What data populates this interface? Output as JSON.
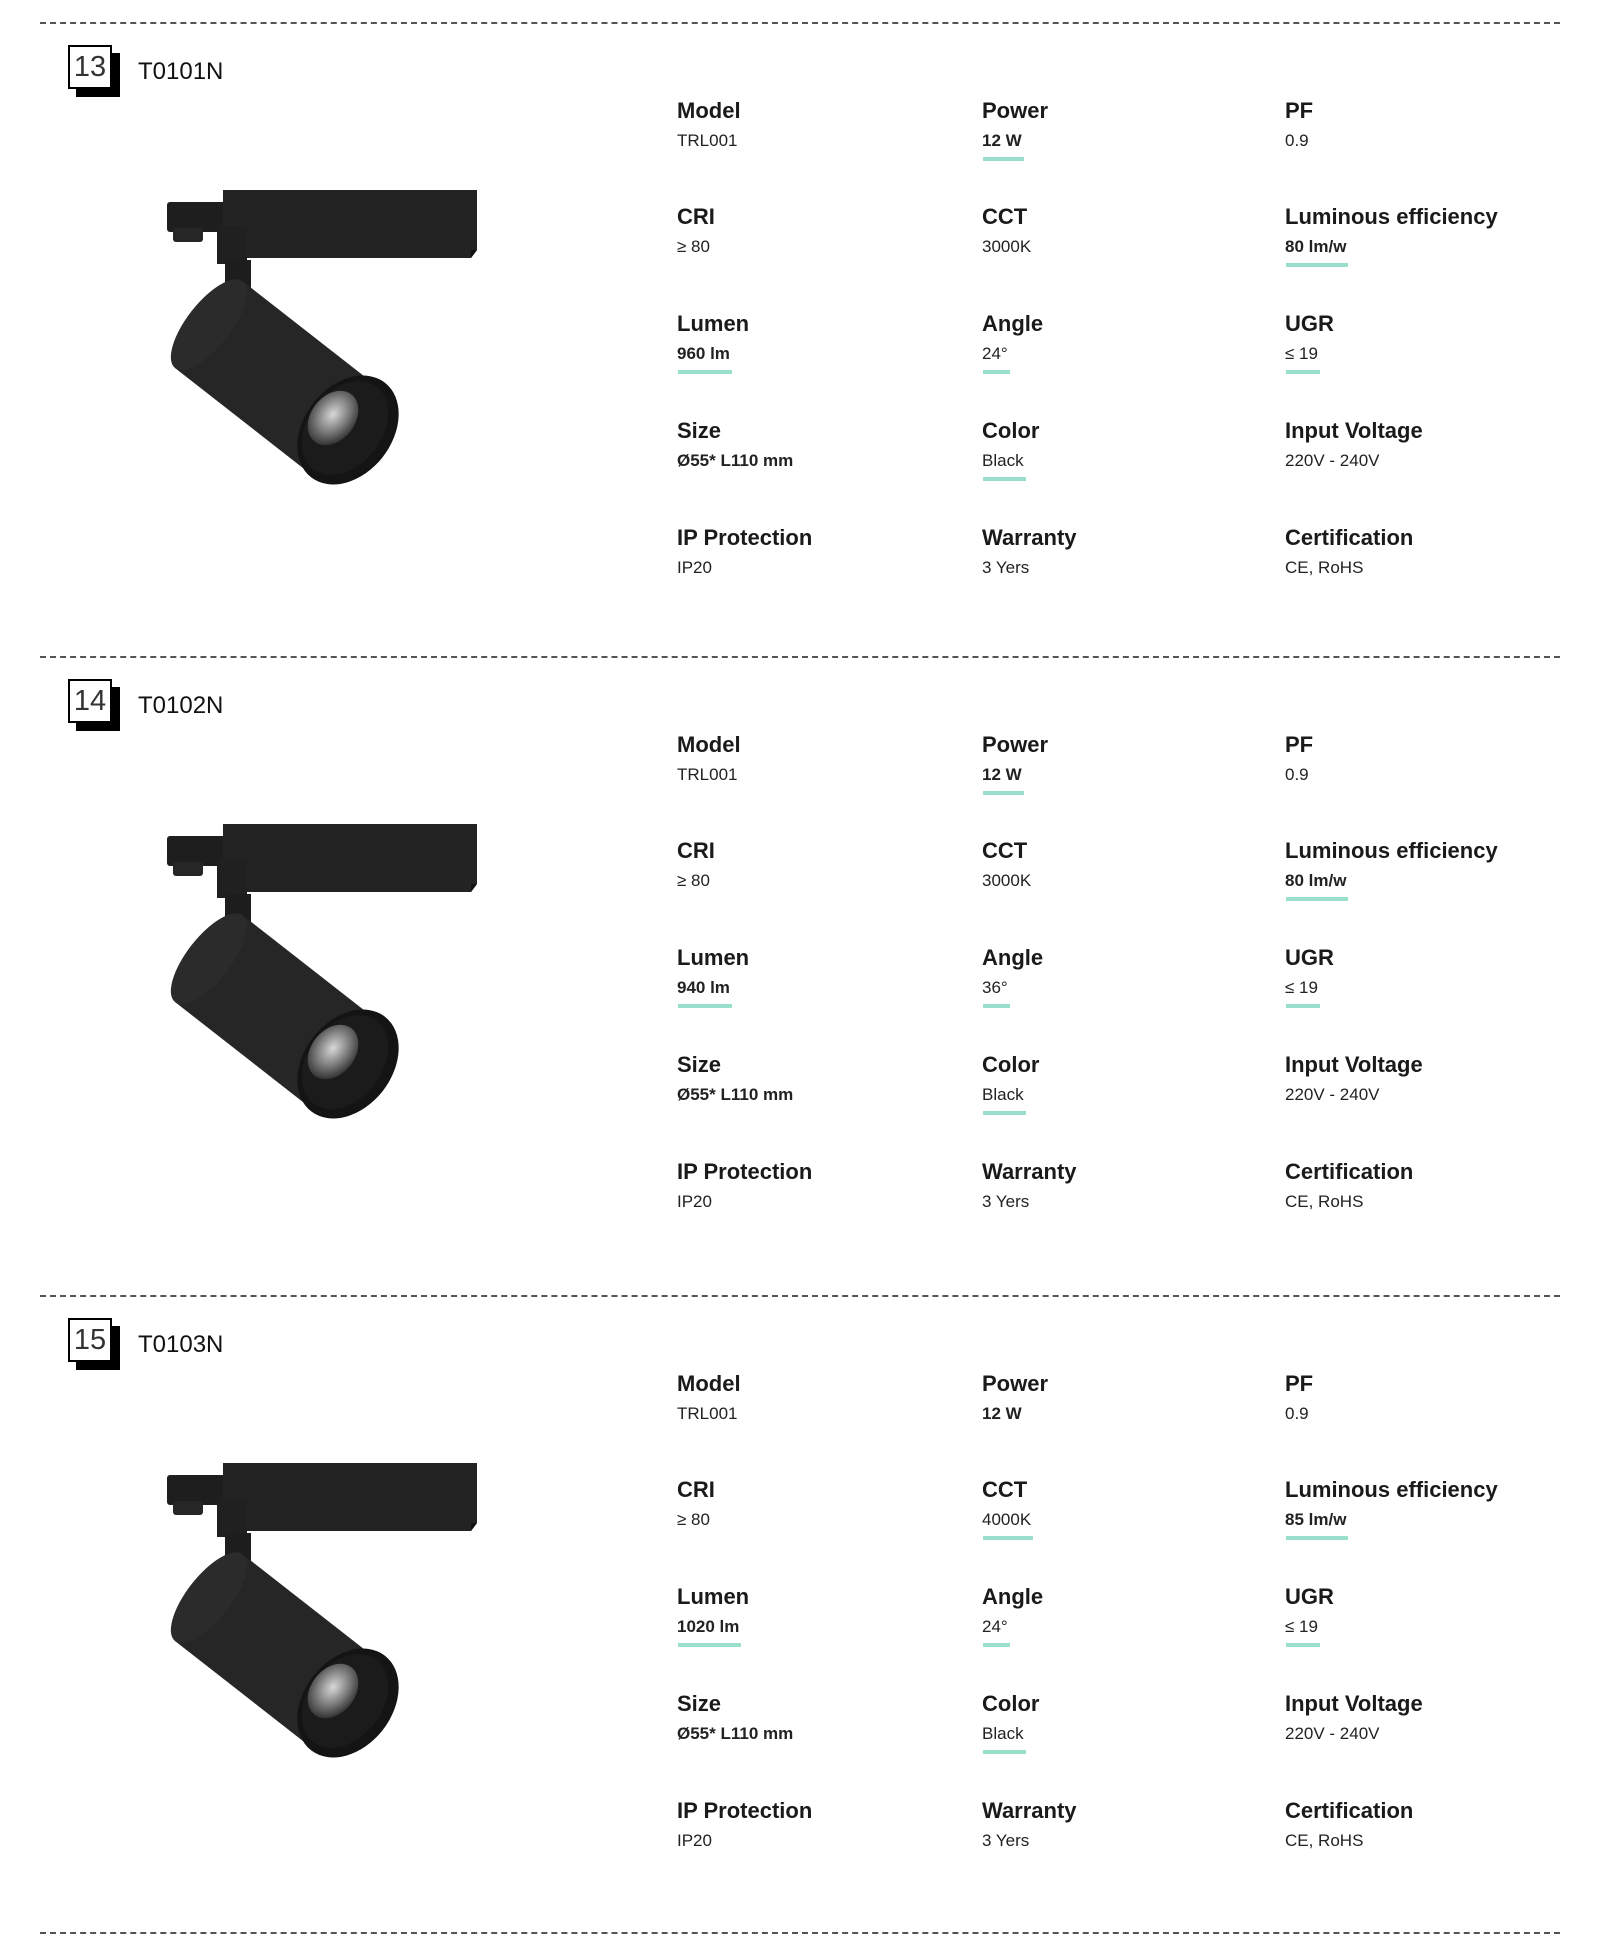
{
  "accent_color": "#9ADFCB",
  "products": [
    {
      "number": "13",
      "code": "T0101N",
      "image": "black-track-spotlight",
      "specs": [
        {
          "label": "Model",
          "value": "TRL001",
          "bold": false,
          "underline": false
        },
        {
          "label": "Power",
          "value": "12 W",
          "bold": true,
          "underline": true
        },
        {
          "label": "PF",
          "value": "0.9",
          "bold": false,
          "underline": false
        },
        {
          "label": "CRI",
          "value": "≥ 80",
          "bold": false,
          "underline": false
        },
        {
          "label": "CCT",
          "value": "3000K",
          "bold": false,
          "underline": false
        },
        {
          "label": "Luminous efficiency",
          "value": "80 lm/w",
          "bold": true,
          "underline": true
        },
        {
          "label": "Lumen",
          "value": "960 lm",
          "bold": true,
          "underline": true
        },
        {
          "label": "Angle",
          "value": "24°",
          "bold": false,
          "underline": true
        },
        {
          "label": "UGR",
          "value": "≤ 19",
          "bold": false,
          "underline": true
        },
        {
          "label": "Size",
          "value": "Ø55* L110 mm",
          "bold": true,
          "underline": false
        },
        {
          "label": "Color",
          "value": "Black",
          "bold": false,
          "underline": true
        },
        {
          "label": "Input Voltage",
          "value": "220V - 240V",
          "bold": false,
          "underline": false
        },
        {
          "label": "IP Protection",
          "value": "IP20",
          "bold": false,
          "underline": false
        },
        {
          "label": "Warranty",
          "value": "3 Yers",
          "bold": false,
          "underline": false
        },
        {
          "label": "Certification",
          "value": "CE, RoHS",
          "bold": false,
          "underline": false
        }
      ]
    },
    {
      "number": "14",
      "code": "T0102N",
      "image": "black-track-spotlight",
      "specs": [
        {
          "label": "Model",
          "value": "TRL001",
          "bold": false,
          "underline": false
        },
        {
          "label": "Power",
          "value": "12 W",
          "bold": true,
          "underline": true
        },
        {
          "label": "PF",
          "value": "0.9",
          "bold": false,
          "underline": false
        },
        {
          "label": "CRI",
          "value": "≥ 80",
          "bold": false,
          "underline": false
        },
        {
          "label": "CCT",
          "value": "3000K",
          "bold": false,
          "underline": false
        },
        {
          "label": "Luminous efficiency",
          "value": "80 lm/w",
          "bold": true,
          "underline": true
        },
        {
          "label": "Lumen",
          "value": "940 lm",
          "bold": true,
          "underline": true
        },
        {
          "label": "Angle",
          "value": "36°",
          "bold": false,
          "underline": true
        },
        {
          "label": "UGR",
          "value": "≤ 19",
          "bold": false,
          "underline": true
        },
        {
          "label": "Size",
          "value": "Ø55* L110 mm",
          "bold": true,
          "underline": false
        },
        {
          "label": "Color",
          "value": "Black",
          "bold": false,
          "underline": true
        },
        {
          "label": "Input Voltage",
          "value": "220V - 240V",
          "bold": false,
          "underline": false
        },
        {
          "label": "IP Protection",
          "value": "IP20",
          "bold": false,
          "underline": false
        },
        {
          "label": "Warranty",
          "value": "3 Yers",
          "bold": false,
          "underline": false
        },
        {
          "label": "Certification",
          "value": "CE, RoHS",
          "bold": false,
          "underline": false
        }
      ]
    },
    {
      "number": "15",
      "code": "T0103N",
      "image": "black-track-spotlight",
      "specs": [
        {
          "label": "Model",
          "value": "TRL001",
          "bold": false,
          "underline": false
        },
        {
          "label": "Power",
          "value": "12 W",
          "bold": true,
          "underline": false
        },
        {
          "label": "PF",
          "value": "0.9",
          "bold": false,
          "underline": false
        },
        {
          "label": "CRI",
          "value": "≥ 80",
          "bold": false,
          "underline": false
        },
        {
          "label": "CCT",
          "value": "4000K",
          "bold": false,
          "underline": true
        },
        {
          "label": "Luminous efficiency",
          "value": "85 lm/w",
          "bold": true,
          "underline": true
        },
        {
          "label": "Lumen",
          "value": "1020 lm",
          "bold": true,
          "underline": true
        },
        {
          "label": "Angle",
          "value": "24°",
          "bold": false,
          "underline": true
        },
        {
          "label": "UGR",
          "value": "≤ 19",
          "bold": false,
          "underline": true
        },
        {
          "label": "Size",
          "value": "Ø55* L110 mm",
          "bold": true,
          "underline": false
        },
        {
          "label": "Color",
          "value": "Black",
          "bold": false,
          "underline": true
        },
        {
          "label": "Input Voltage",
          "value": "220V - 240V",
          "bold": false,
          "underline": false
        },
        {
          "label": "IP Protection",
          "value": "IP20",
          "bold": false,
          "underline": false
        },
        {
          "label": "Warranty",
          "value": "3 Yers",
          "bold": false,
          "underline": false
        },
        {
          "label": "Certification",
          "value": "CE, RoHS",
          "bold": false,
          "underline": false
        }
      ]
    }
  ]
}
